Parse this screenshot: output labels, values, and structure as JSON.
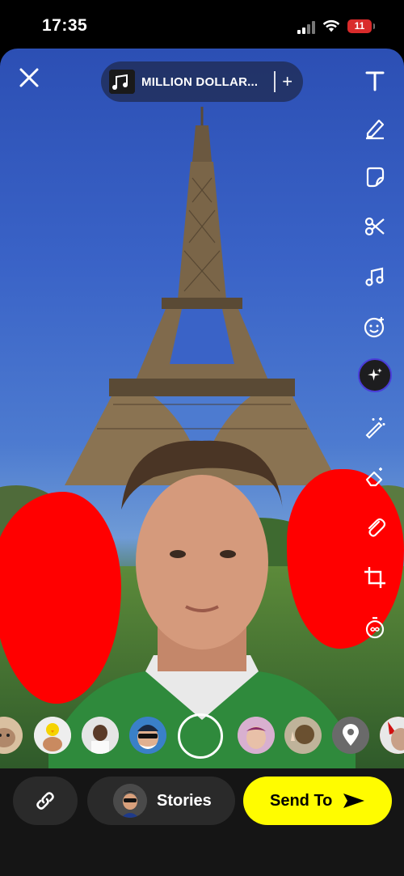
{
  "status_bar": {
    "time": "17:35",
    "battery": "11"
  },
  "music": {
    "title": "MILLION DOLLAR...",
    "add_symbol": "+"
  },
  "toolbar": {
    "tools": [
      "text-icon",
      "pencil-icon",
      "sticker-icon",
      "scissors-icon",
      "music-note-icon",
      "emoji-icon",
      "ai-sparkle-icon",
      "magic-wand-icon",
      "eraser-icon",
      "paperclip-icon",
      "crop-icon",
      "timer-icon"
    ]
  },
  "bottom": {
    "stories_label": "Stories",
    "send_label": "Send To"
  },
  "colors": {
    "accent_yellow": "#fffc00",
    "redaction": "#ff0000",
    "panel": "#2a2a2a"
  }
}
